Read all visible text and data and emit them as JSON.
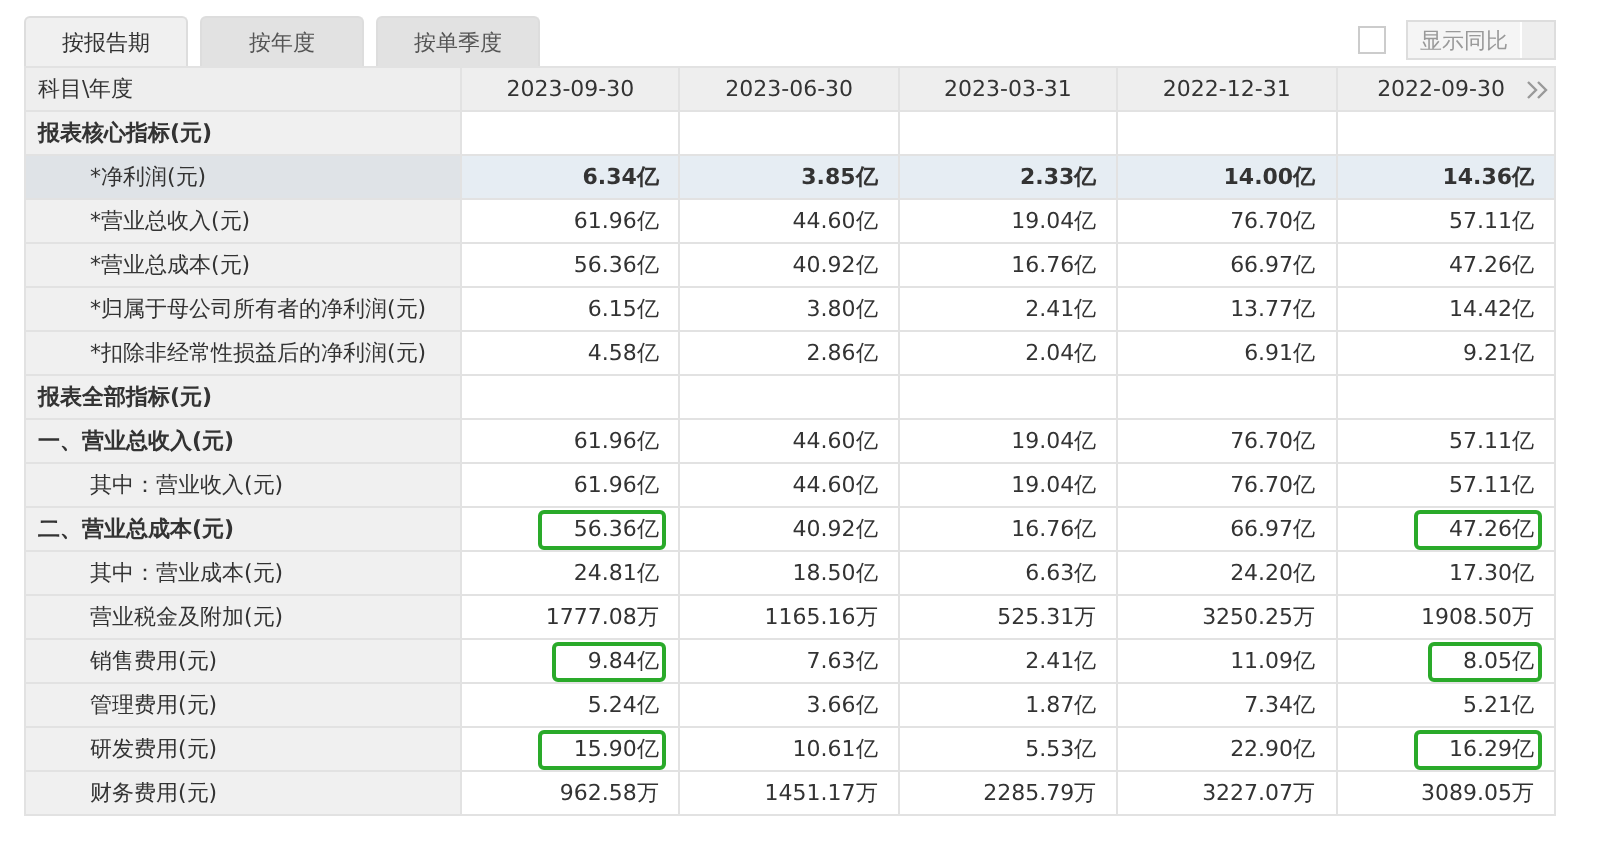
{
  "tabs": [
    {
      "label": "按报告期",
      "selected": true
    },
    {
      "label": "按年度",
      "selected": false
    },
    {
      "label": "按单季度",
      "selected": false
    }
  ],
  "compare": {
    "checked": false,
    "label": "显示同比"
  },
  "table": {
    "label_header": "科目\\年度",
    "columns": [
      "2023-09-30",
      "2023-06-30",
      "2023-03-31",
      "2022-12-31",
      "2022-09-30"
    ],
    "rows": [
      {
        "kind": "section",
        "label": "报表核心指标(元)",
        "cells": []
      },
      {
        "kind": "key",
        "label": "*净利润(元)",
        "cells": [
          {
            "text": "6.34亿",
            "boxed": false
          },
          {
            "text": "3.85亿",
            "boxed": false
          },
          {
            "text": "2.33亿",
            "boxed": false
          },
          {
            "text": "14.00亿",
            "boxed": false
          },
          {
            "text": "14.36亿",
            "boxed": false
          }
        ]
      },
      {
        "kind": "item",
        "label": "*营业总收入(元)",
        "cells": [
          {
            "text": "61.96亿",
            "boxed": false
          },
          {
            "text": "44.60亿",
            "boxed": false
          },
          {
            "text": "19.04亿",
            "boxed": false
          },
          {
            "text": "76.70亿",
            "boxed": false
          },
          {
            "text": "57.11亿",
            "boxed": false
          }
        ]
      },
      {
        "kind": "item",
        "label": "*营业总成本(元)",
        "cells": [
          {
            "text": "56.36亿",
            "boxed": false
          },
          {
            "text": "40.92亿",
            "boxed": false
          },
          {
            "text": "16.76亿",
            "boxed": false
          },
          {
            "text": "66.97亿",
            "boxed": false
          },
          {
            "text": "47.26亿",
            "boxed": false
          }
        ]
      },
      {
        "kind": "item",
        "label": "*归属于母公司所有者的净利润(元)",
        "cells": [
          {
            "text": "6.15亿",
            "boxed": false
          },
          {
            "text": "3.80亿",
            "boxed": false
          },
          {
            "text": "2.41亿",
            "boxed": false
          },
          {
            "text": "13.77亿",
            "boxed": false
          },
          {
            "text": "14.42亿",
            "boxed": false
          }
        ]
      },
      {
        "kind": "item",
        "label": "*扣除非经常性损益后的净利润(元)",
        "cells": [
          {
            "text": "4.58亿",
            "boxed": false
          },
          {
            "text": "2.86亿",
            "boxed": false
          },
          {
            "text": "2.04亿",
            "boxed": false
          },
          {
            "text": "6.91亿",
            "boxed": false
          },
          {
            "text": "9.21亿",
            "boxed": false
          }
        ]
      },
      {
        "kind": "section",
        "label": "报表全部指标(元)",
        "cells": []
      },
      {
        "kind": "total",
        "label": "一、营业总收入(元)",
        "cells": [
          {
            "text": "61.96亿",
            "boxed": false
          },
          {
            "text": "44.60亿",
            "boxed": false
          },
          {
            "text": "19.04亿",
            "boxed": false
          },
          {
            "text": "76.70亿",
            "boxed": false
          },
          {
            "text": "57.11亿",
            "boxed": false
          }
        ]
      },
      {
        "kind": "item",
        "label": "其中：营业收入(元)",
        "cells": [
          {
            "text": "61.96亿",
            "boxed": false
          },
          {
            "text": "44.60亿",
            "boxed": false
          },
          {
            "text": "19.04亿",
            "boxed": false
          },
          {
            "text": "76.70亿",
            "boxed": false
          },
          {
            "text": "57.11亿",
            "boxed": false
          }
        ]
      },
      {
        "kind": "total",
        "label": "二、营业总成本(元)",
        "cells": [
          {
            "text": "56.36亿",
            "boxed": true
          },
          {
            "text": "40.92亿",
            "boxed": false
          },
          {
            "text": "16.76亿",
            "boxed": false
          },
          {
            "text": "66.97亿",
            "boxed": false
          },
          {
            "text": "47.26亿",
            "boxed": true
          }
        ]
      },
      {
        "kind": "item",
        "label": "其中：营业成本(元)",
        "cells": [
          {
            "text": "24.81亿",
            "boxed": false
          },
          {
            "text": "18.50亿",
            "boxed": false
          },
          {
            "text": "6.63亿",
            "boxed": false
          },
          {
            "text": "24.20亿",
            "boxed": false
          },
          {
            "text": "17.30亿",
            "boxed": false
          }
        ]
      },
      {
        "kind": "item",
        "label": "营业税金及附加(元)",
        "cells": [
          {
            "text": "1777.08万",
            "boxed": false
          },
          {
            "text": "1165.16万",
            "boxed": false
          },
          {
            "text": "525.31万",
            "boxed": false
          },
          {
            "text": "3250.25万",
            "boxed": false
          },
          {
            "text": "1908.50万",
            "boxed": false
          }
        ]
      },
      {
        "kind": "item",
        "label": "销售费用(元)",
        "cells": [
          {
            "text": "9.84亿",
            "boxed": true
          },
          {
            "text": "7.63亿",
            "boxed": false
          },
          {
            "text": "2.41亿",
            "boxed": false
          },
          {
            "text": "11.09亿",
            "boxed": false
          },
          {
            "text": "8.05亿",
            "boxed": true
          }
        ]
      },
      {
        "kind": "item",
        "label": "管理费用(元)",
        "cells": [
          {
            "text": "5.24亿",
            "boxed": false
          },
          {
            "text": "3.66亿",
            "boxed": false
          },
          {
            "text": "1.87亿",
            "boxed": false
          },
          {
            "text": "7.34亿",
            "boxed": false
          },
          {
            "text": "5.21亿",
            "boxed": false
          }
        ]
      },
      {
        "kind": "item",
        "label": "研发费用(元)",
        "cells": [
          {
            "text": "15.90亿",
            "boxed": true
          },
          {
            "text": "10.61亿",
            "boxed": false
          },
          {
            "text": "5.53亿",
            "boxed": false
          },
          {
            "text": "22.90亿",
            "boxed": false
          },
          {
            "text": "16.29亿",
            "boxed": true
          }
        ]
      },
      {
        "kind": "item",
        "label": "财务费用(元)",
        "cells": [
          {
            "text": "962.58万",
            "boxed": false
          },
          {
            "text": "1451.17万",
            "boxed": false
          },
          {
            "text": "2285.79万",
            "boxed": false
          },
          {
            "text": "3227.07万",
            "boxed": false
          },
          {
            "text": "3089.05万",
            "boxed": false
          }
        ]
      }
    ]
  }
}
